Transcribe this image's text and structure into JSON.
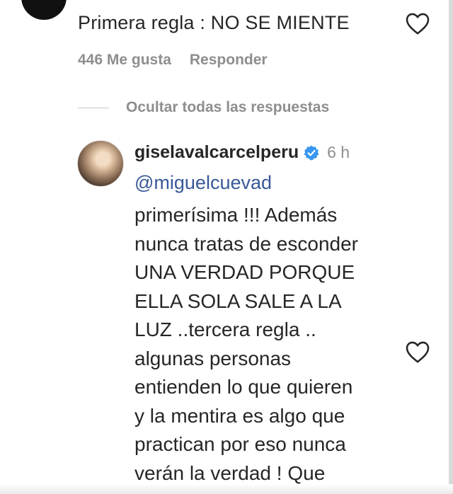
{
  "top_comment": {
    "text": "Primera regla : NO SE MIENTE",
    "likes": "446 Me gusta",
    "reply_label": "Responder"
  },
  "hide_replies_label": "Ocultar todas las respuestas",
  "reply": {
    "username": "giselavalcarcelperu",
    "time": "6 h",
    "mention": "@miguelcuevad",
    "lines": [
      "primerísima !!! Además",
      "nunca tratas de esconder",
      "UNA VERDAD PORQUE",
      "ELLA SOLA SALE A LA",
      "LUZ ..tercera regla ..",
      "algunas personas",
      "entienden lo que quieren",
      "y la mentira es algo que",
      "practican por eso nunca",
      "verán la verdad ! Que"
    ]
  },
  "icons": {
    "like": "heart-icon",
    "verified": "verified-badge-icon"
  },
  "colors": {
    "text": "#262626",
    "muted": "#8e8e8e",
    "mention": "#385898",
    "verified": "#3897f0"
  }
}
